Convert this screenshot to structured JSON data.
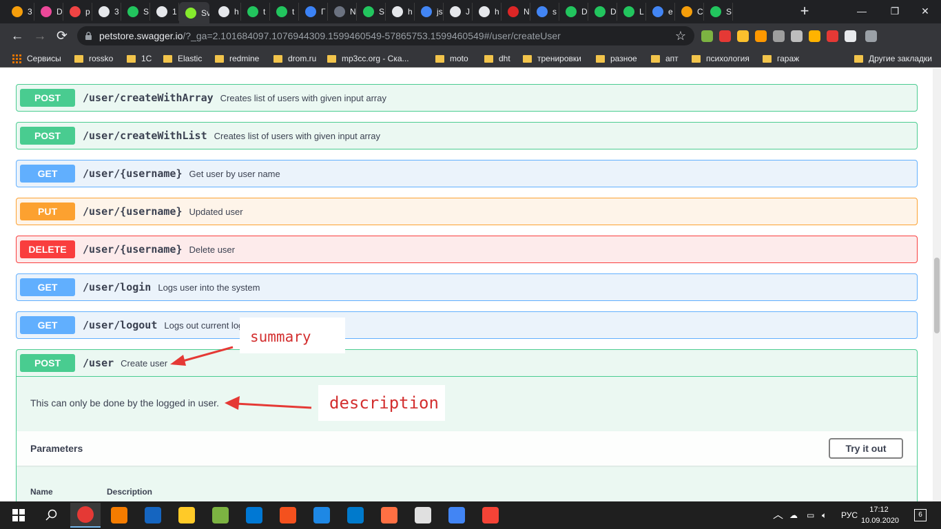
{
  "browser": {
    "tabs": [
      {
        "label": "3",
        "color": "#f59e0b"
      },
      {
        "label": "D",
        "color": "#ec4899"
      },
      {
        "label": "p",
        "color": "#ef4444"
      },
      {
        "label": "3",
        "color": "#e5e7eb"
      },
      {
        "label": "S",
        "color": "#22c55e"
      },
      {
        "label": "1",
        "color": "#e5e7eb"
      },
      {
        "label": "Sv",
        "color": "#85ea2d"
      },
      {
        "label": "h",
        "color": "#e5e7eb"
      },
      {
        "label": "t",
        "color": "#22c55e"
      },
      {
        "label": "t",
        "color": "#22c55e"
      },
      {
        "label": "Г",
        "color": "#3b82f6"
      },
      {
        "label": "N",
        "color": "#6b7280"
      },
      {
        "label": "S",
        "color": "#22c55e"
      },
      {
        "label": "h",
        "color": "#e5e7eb"
      },
      {
        "label": "js",
        "color": "#4285f4"
      },
      {
        "label": "J",
        "color": "#e5e7eb"
      },
      {
        "label": "h",
        "color": "#e5e7eb"
      },
      {
        "label": "N",
        "color": "#dc2626"
      },
      {
        "label": "s",
        "color": "#4285f4"
      },
      {
        "label": "D",
        "color": "#22c55e"
      },
      {
        "label": "D",
        "color": "#22c55e"
      },
      {
        "label": "L",
        "color": "#22c55e"
      },
      {
        "label": "e",
        "color": "#4285f4"
      },
      {
        "label": "C",
        "color": "#f59e0b"
      },
      {
        "label": "S",
        "color": "#22c55e"
      }
    ],
    "active_tab_close": "✕",
    "new_tab": "+",
    "window_controls": [
      "—",
      "❐",
      "✕"
    ],
    "url_host": "petstore.swagger.io",
    "url_rest": "/?_ga=2.101684097.1076944309.1599460549-57865753.1599460549#/user/createUser",
    "bookmarks": [
      "Сервисы",
      "rossko",
      "1С",
      "Elastic",
      "redmine",
      "drom.ru",
      "mp3cc.org - Ска...",
      "moto",
      "dht",
      "тренировки",
      "разное",
      "апт",
      "психология",
      "гараж"
    ],
    "other_bookmarks": "Другие закладки",
    "extensions": [
      "#7cb342",
      "#e53935",
      "#fbc02d",
      "#ff9800",
      "#9e9e9e",
      "#bdbdbd",
      "#ffb300",
      "#e53935",
      "#e8eaed",
      "#9aa0a6"
    ]
  },
  "operations": [
    {
      "method": "POST",
      "path": "/user/createWithArray",
      "summary": "Creates list of users with given input array"
    },
    {
      "method": "POST",
      "path": "/user/createWithList",
      "summary": "Creates list of users with given input array"
    },
    {
      "method": "GET",
      "path": "/user/{username}",
      "summary": "Get user by user name"
    },
    {
      "method": "PUT",
      "path": "/user/{username}",
      "summary": "Updated user"
    },
    {
      "method": "DELETE",
      "path": "/user/{username}",
      "summary": "Delete user"
    },
    {
      "method": "GET",
      "path": "/user/login",
      "summary": "Logs user into the system"
    },
    {
      "method": "GET",
      "path": "/user/logout",
      "summary": "Logs out current logged in user session"
    }
  ],
  "expanded_op": {
    "method": "POST",
    "path": "/user",
    "summary": "Create user",
    "description": "This can only be done by the logged in user.",
    "parameters_title": "Parameters",
    "try_button": "Try it out",
    "columns": [
      "Name",
      "Description"
    ]
  },
  "annotations": {
    "summary_note": "summary",
    "description_note": "description",
    "arrow_color": "#e53935"
  },
  "taskbar": {
    "apps": [
      "#e53935",
      "#f57c00",
      "#1565c0",
      "#ffca28",
      "#7cb342",
      "#0078d4",
      "#f4511e",
      "#1e88e5",
      "#007acc",
      "#ff7043",
      "#e0e0e0",
      "#4285f4",
      "#f44336"
    ],
    "tray_lang": "РУС",
    "time": "17:12",
    "date": "10.09.2020",
    "notifications": "6"
  }
}
